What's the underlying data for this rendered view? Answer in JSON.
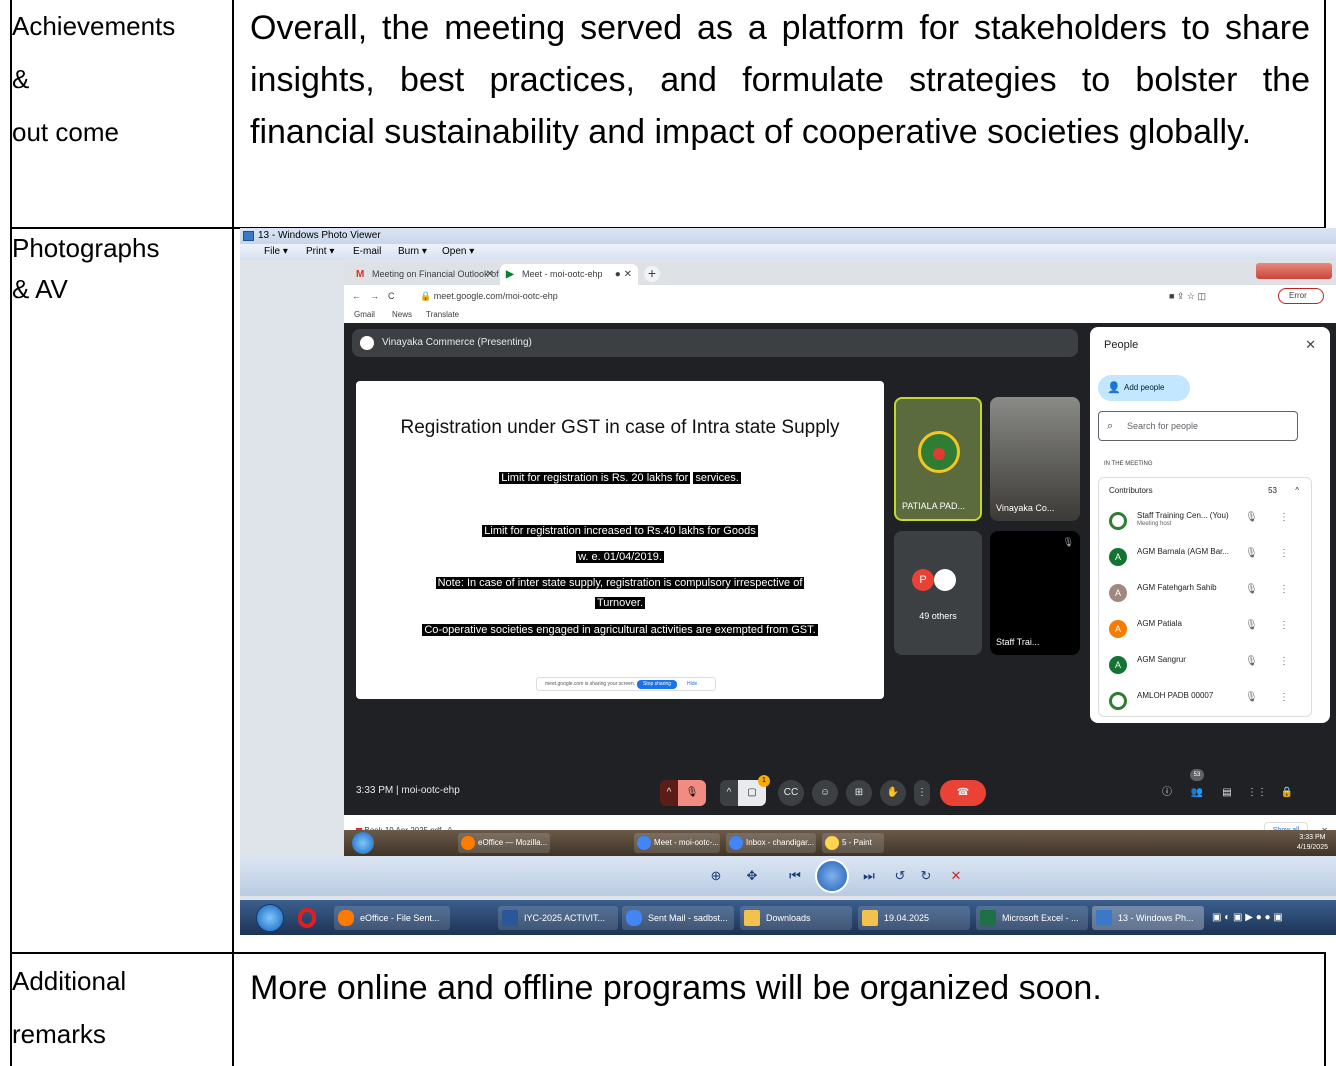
{
  "rows": [
    {
      "label_lines": [
        "Achievements",
        "&",
        "out come"
      ],
      "text": "Overall, the meeting served as a platform for stakeholders to share insights, best practices, and formulate strategies to bolster the financial sustainability and impact of cooperative societies globally."
    },
    {
      "label_lines": [
        "Photographs",
        "& AV"
      ]
    },
    {
      "label_lines": [
        "Additional",
        "remarks"
      ],
      "text": "More online and offline programs will be organized soon."
    }
  ],
  "photo": {
    "viewer_title": "13 - Windows Photo Viewer",
    "viewer_menu": [
      "File ▾",
      "Print ▾",
      "E-mail",
      "Burn ▾",
      "Open ▾"
    ],
    "browser": {
      "tabs": [
        "Meeting on Financial Outlook of",
        "Meet - moi-ootc-ehp"
      ],
      "url": "meet.google.com/moi-ootc-ehp",
      "error_label": "Error",
      "bookmarks": [
        "Gmail",
        "News",
        "Translate"
      ]
    },
    "meet": {
      "presenting_label": "Vinayaka Commerce (Presenting)",
      "slide": {
        "title": "Registration under GST in case of Intra state Supply",
        "line1a": "Limit for registration is Rs. 20 lakhs for",
        "line1b": "services.",
        "line2": "Limit for registration increased to Rs.40 lakhs for Goods",
        "line3": "w. e.  01/04/2019.",
        "line4": "Note: In case of inter state supply, registration is compulsory irrespective of",
        "line5": "Turnover.",
        "line6": "Co-operative societies engaged in agricultural activities are exempted from GST.",
        "share_text": "meet.google.com is sharing your screen.",
        "stop_label": "Stop sharing",
        "hide_label": "Hide"
      },
      "tiles": {
        "patiala": "PATIALA PAD...",
        "vinayaka": "Vinayaka Co...",
        "others": "49 others",
        "others_avatar": "P",
        "staff": "Staff Trai..."
      },
      "people_panel": {
        "header": "People",
        "add_people": "Add people",
        "search_placeholder": "Search for people",
        "in_meeting": "IN THE MEETING",
        "contributors_label": "Contributors",
        "contributors_count": "53",
        "participants": [
          {
            "initial": "",
            "name": "Staff Training Cen... (You)",
            "sub": "Meeting host",
            "color": "#ffffff"
          },
          {
            "initial": "A",
            "name": "AGM Barnala (AGM Bar...",
            "sub": "",
            "color": "#137333"
          },
          {
            "initial": "A",
            "name": "AGM Fatehgarh Sahib",
            "sub": "",
            "color": "#a1887f"
          },
          {
            "initial": "A",
            "name": "AGM Patiala",
            "sub": "",
            "color": "#f57c00"
          },
          {
            "initial": "A",
            "name": "AGM Sangrur",
            "sub": "",
            "color": "#137333"
          },
          {
            "initial": "",
            "name": "AMLOH PADB 00007",
            "sub": "",
            "color": "#ffffff"
          }
        ]
      },
      "time_code": "3:33 PM  |  moi-ootc-ehp",
      "people_badge": "53",
      "notification_badge": "1"
    },
    "download": {
      "file": "Book 19 Apr 2025.pdf",
      "show_all": "Show all"
    },
    "inner_taskbar": {
      "items": [
        "eOffice — Mozilla...",
        "Meet - moi-ootc-...",
        "Inbox - chandigar...",
        "5 - Paint"
      ],
      "time": "3:33 PM",
      "date": "4/19/2025"
    },
    "outer_taskbar": {
      "items": [
        "eOffice - File Sent...",
        "IYC-2025 ACTIVIT...",
        "Sent Mail - sadbst...",
        "Downloads",
        "19.04.2025",
        "Microsoft Excel - ...",
        "13 - Windows Ph..."
      ]
    }
  },
  "colors": {
    "meet_bg": "#202124",
    "end_call": "#ea4335",
    "taskbar": "#1d3355"
  }
}
